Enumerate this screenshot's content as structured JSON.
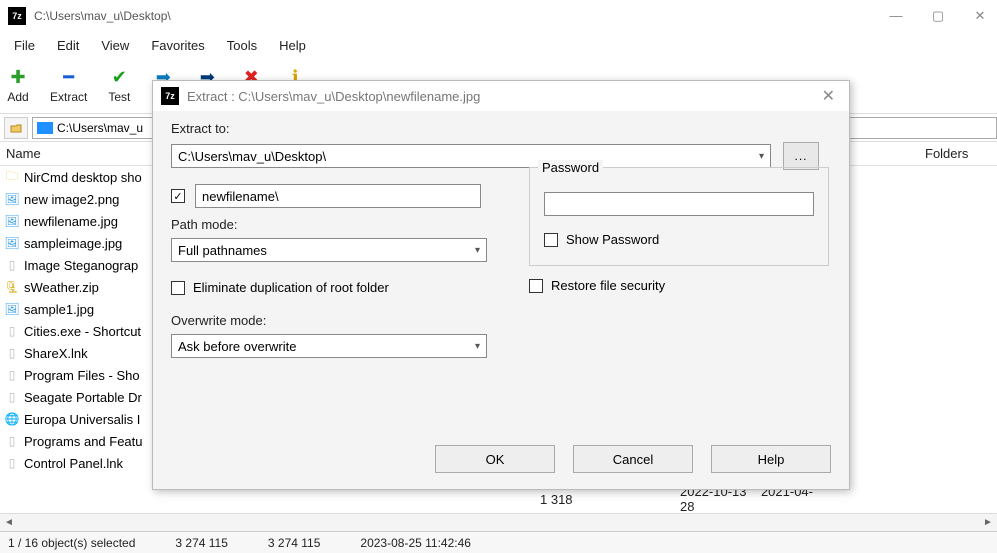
{
  "main_window": {
    "title": "C:\\Users\\mav_u\\Desktop\\",
    "app_icon_text": "7z"
  },
  "menubar": [
    "File",
    "Edit",
    "View",
    "Favorites",
    "Tools",
    "Help"
  ],
  "toolbar": {
    "add": "Add",
    "extract": "Extract",
    "test": "Test"
  },
  "addressbar": {
    "path": "C:\\Users\\mav_u"
  },
  "columns": {
    "name": "Name",
    "folders": "Folders"
  },
  "files": [
    {
      "icon": "folder",
      "name": "NirCmd desktop sho"
    },
    {
      "icon": "image",
      "name": "new image2.png"
    },
    {
      "icon": "image",
      "name": "newfilename.jpg"
    },
    {
      "icon": "image",
      "name": "sampleimage.jpg"
    },
    {
      "icon": "file",
      "name": "Image Steganograp"
    },
    {
      "icon": "zip",
      "name": "sWeather.zip"
    },
    {
      "icon": "image",
      "name": "sample1.jpg"
    },
    {
      "icon": "file",
      "name": "Cities.exe - Shortcut"
    },
    {
      "icon": "file",
      "name": "ShareX.lnk"
    },
    {
      "icon": "file",
      "name": "Program Files - Sho"
    },
    {
      "icon": "file",
      "name": "Seagate Portable Dr"
    },
    {
      "icon": "globe",
      "name": "Europa Universalis I"
    },
    {
      "icon": "file",
      "name": "Programs and Featu"
    },
    {
      "icon": "file",
      "name": "Control Panel.lnk"
    }
  ],
  "partial_row": {
    "size": "1 318",
    "date1": "2022-10-13",
    "date2": "2021-04-28"
  },
  "statusbar": {
    "selection": "1 / 16 object(s) selected",
    "size1": "3 274 115",
    "size2": "3 274 115",
    "datetime": "2023-08-25 11:42:46"
  },
  "dialog": {
    "title": "Extract : C:\\Users\\mav_u\\Desktop\\newfilename.jpg",
    "extract_to_label": "Extract to:",
    "extract_to_value": "C:\\Users\\mav_u\\Desktop\\",
    "browse_btn": "...",
    "subfolder_value": "newfilename\\",
    "path_mode_label": "Path mode:",
    "path_mode_value": "Full pathnames",
    "eliminate_dup": "Eliminate duplication of root folder",
    "overwrite_label": "Overwrite mode:",
    "overwrite_value": "Ask before overwrite",
    "password_label": "Password",
    "show_password": "Show Password",
    "restore_security": "Restore file security",
    "ok": "OK",
    "cancel": "Cancel",
    "help": "Help"
  }
}
